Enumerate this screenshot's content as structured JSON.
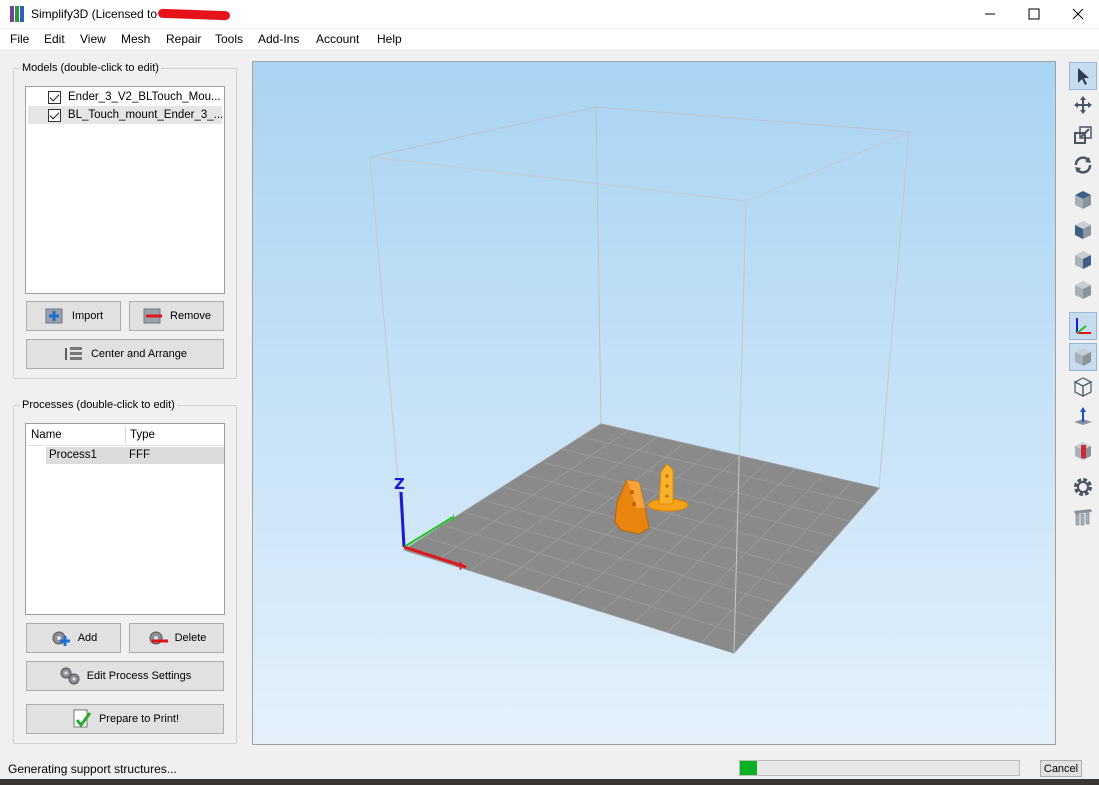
{
  "window": {
    "title": "Simplify3D (Licensed to",
    "controls": {
      "minimize": "minimize-icon",
      "maximize": "maximize-icon",
      "close": "close-icon"
    }
  },
  "menu": [
    "File",
    "Edit",
    "View",
    "Mesh",
    "Repair",
    "Tools",
    "Add-Ins",
    "Account",
    "Help"
  ],
  "models_panel": {
    "title": "Models (double-click to edit)",
    "items": [
      {
        "label": "Ender_3_V2_BLTouch_Mou...",
        "checked": true
      },
      {
        "label": "BL_Touch_mount_Ender_3_...",
        "checked": true
      }
    ],
    "import_label": "Import",
    "remove_label": "Remove",
    "center_label": "Center and Arrange"
  },
  "processes_panel": {
    "title": "Processes (double-click to edit)",
    "columns": [
      "Name",
      "Type"
    ],
    "rows": [
      {
        "name": "Process1",
        "type": "FFF"
      }
    ],
    "add_label": "Add",
    "delete_label": "Delete",
    "edit_label": "Edit Process Settings",
    "prepare_label": "Prepare to Print!"
  },
  "viewport": {
    "axis_label": "Z",
    "colors": {
      "axis_x": "#e0151b",
      "axis_y": "#22c22a",
      "axis_z": "#1a1ad0",
      "model": "#f28a0c",
      "bed": "#8a8a8a"
    }
  },
  "toolbar_icons": [
    "select-icon",
    "move-icon",
    "scale-icon",
    "rotate-icon",
    "view-top-icon",
    "view-front-icon",
    "view-side-icon",
    "view-iso-icon",
    "axes-icon",
    "solid-icon",
    "wireframe-icon",
    "normals-icon",
    "cross-section-icon",
    "settings-gear-icon",
    "supports-icon"
  ],
  "status": {
    "message": "Generating support structures...",
    "progress": 0.06,
    "cancel_label": "Cancel"
  }
}
